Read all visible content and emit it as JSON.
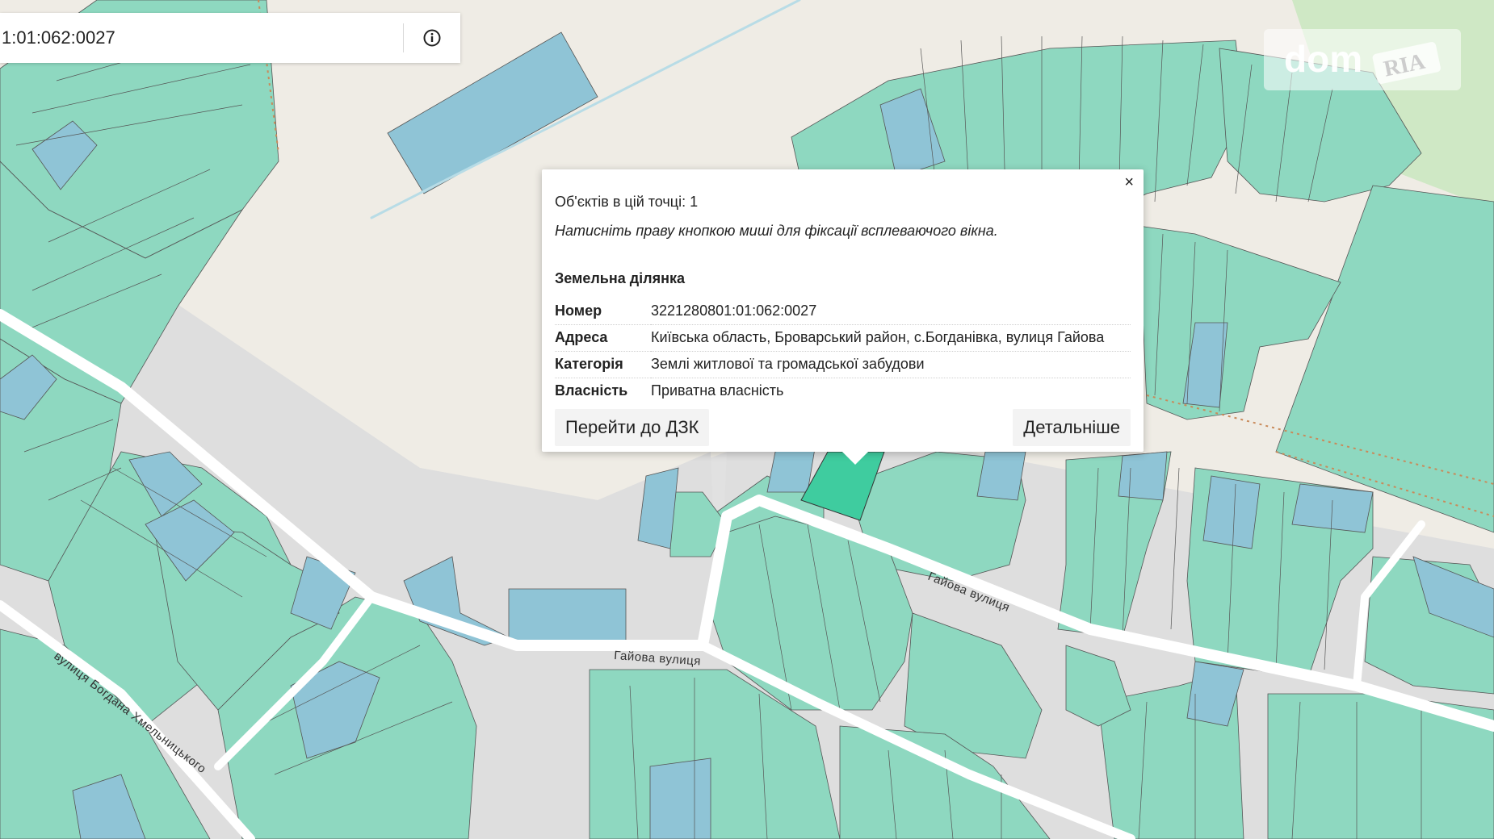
{
  "search": {
    "value": "1:01:062:0027"
  },
  "icons": {
    "info": "info-circle-icon",
    "close": "close-icon"
  },
  "watermark": {
    "brand": "dom",
    "badge": "RIA"
  },
  "roads": {
    "gaiova_1": "Гайова вулиця",
    "gaiova_2": "Гайова вулиця",
    "khmelnytskoho": "вулиця Богдана Хмельницького"
  },
  "popup": {
    "close_label": "×",
    "count_text": "Об'єктів в цій точці: 1",
    "hint_text": "Натисніть праву кнопкою миші для фіксації всплеваючого вікна.",
    "section_title": "Земельна ділянка",
    "rows": [
      {
        "key": "Номер",
        "value": "3221280801:01:062:0027"
      },
      {
        "key": "Адреса",
        "value": "Київська область, Броварський район, с.Богданівка, вулиця Гайова"
      },
      {
        "key": "Категорія",
        "value": "Землі житлової та громадської забудови"
      },
      {
        "key": "Власність",
        "value": "Приватна власність"
      }
    ],
    "btn_dzk": "Перейти до ДЗК",
    "btn_details": "Детальніше"
  },
  "colors": {
    "background": "#e1e1e1",
    "land": "#efece5",
    "parcel_green": "#8ed8c0",
    "parcel_blue": "#8fc4d6",
    "parcel_selected": "#3fcc9f",
    "road": "#ffffff",
    "forest": "#cfe8c5"
  }
}
